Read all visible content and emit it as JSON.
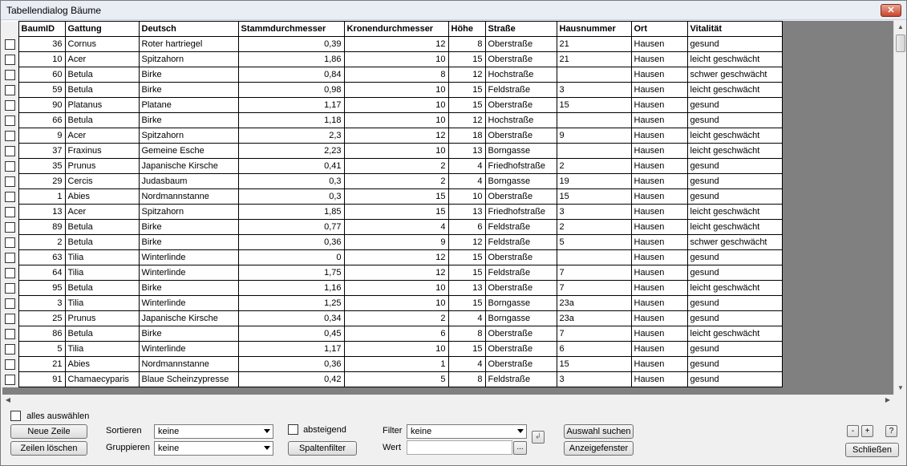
{
  "window": {
    "title": "Tabellendialog Bäume",
    "close_label": "✕"
  },
  "columns": [
    "BaumID",
    "Gattung",
    "Deutsch",
    "Stammdurchmesser",
    "Kronendurchmesser",
    "Höhe",
    "Straße",
    "Hausnummer",
    "Ort",
    "Vitalität"
  ],
  "rows": [
    [
      "36",
      "Cornus",
      "Roter hartriegel",
      "0,39",
      "12",
      "8",
      "Oberstraße",
      "21",
      "Hausen",
      "gesund"
    ],
    [
      "10",
      "Acer",
      "Spitzahorn",
      "1,86",
      "10",
      "15",
      "Oberstraße",
      "21",
      "Hausen",
      "leicht geschwächt"
    ],
    [
      "60",
      "Betula",
      "Birke",
      "0,84",
      "8",
      "12",
      "Hochstraße",
      "",
      "Hausen",
      "schwer geschwächt"
    ],
    [
      "59",
      "Betula",
      "Birke",
      "0,98",
      "10",
      "15",
      "Feldstraße",
      "3",
      "Hausen",
      "leicht geschwächt"
    ],
    [
      "90",
      "Platanus",
      "Platane",
      "1,17",
      "10",
      "15",
      "Oberstraße",
      "15",
      "Hausen",
      "gesund"
    ],
    [
      "66",
      "Betula",
      "Birke",
      "1,18",
      "10",
      "12",
      "Hochstraße",
      "",
      "Hausen",
      "gesund"
    ],
    [
      "9",
      "Acer",
      "Spitzahorn",
      "2,3",
      "12",
      "18",
      "Oberstraße",
      "9",
      "Hausen",
      "leicht geschwächt"
    ],
    [
      "37",
      "Fraxinus",
      "Gemeine Esche",
      "2,23",
      "10",
      "13",
      "Borngasse",
      "",
      "Hausen",
      "leicht geschwächt"
    ],
    [
      "35",
      "Prunus",
      "Japanische Kirsche",
      "0,41",
      "2",
      "4",
      "Friedhofstraße",
      "2",
      "Hausen",
      "gesund"
    ],
    [
      "29",
      "Cercis",
      "Judasbaum",
      "0,3",
      "2",
      "4",
      "Borngasse",
      "19",
      "Hausen",
      "gesund"
    ],
    [
      "1",
      "Abies",
      "Nordmannstanne",
      "0,3",
      "15",
      "10",
      "Oberstraße",
      "15",
      "Hausen",
      "gesund"
    ],
    [
      "13",
      "Acer",
      "Spitzahorn",
      "1,85",
      "15",
      "13",
      "Friedhofstraße",
      "3",
      "Hausen",
      "leicht geschwächt"
    ],
    [
      "89",
      "Betula",
      "Birke",
      "0,77",
      "4",
      "6",
      "Feldstraße",
      "2",
      "Hausen",
      "leicht geschwächt"
    ],
    [
      "2",
      "Betula",
      "Birke",
      "0,36",
      "9",
      "12",
      "Feldstraße",
      "5",
      "Hausen",
      "schwer geschwächt"
    ],
    [
      "63",
      "Tilia",
      "Winterlinde",
      "0",
      "12",
      "15",
      "Oberstraße",
      "",
      "Hausen",
      "gesund"
    ],
    [
      "64",
      "Tilia",
      "Winterlinde",
      "1,75",
      "12",
      "15",
      "Feldstraße",
      "7",
      "Hausen",
      "gesund"
    ],
    [
      "95",
      "Betula",
      "Birke",
      "1,16",
      "10",
      "13",
      "Oberstraße",
      "7",
      "Hausen",
      "leicht geschwächt"
    ],
    [
      "3",
      "Tilia",
      "Winterlinde",
      "1,25",
      "10",
      "15",
      "Borngasse",
      "23a",
      "Hausen",
      "gesund"
    ],
    [
      "25",
      "Prunus",
      "Japanische Kirsche",
      "0,34",
      "2",
      "4",
      "Borngasse",
      "23a",
      "Hausen",
      "gesund"
    ],
    [
      "86",
      "Betula",
      "Birke",
      "0,45",
      "6",
      "8",
      "Oberstraße",
      "7",
      "Hausen",
      "leicht geschwächt"
    ],
    [
      "5",
      "Tilia",
      "Winterlinde",
      "1,17",
      "10",
      "15",
      "Oberstraße",
      "6",
      "Hausen",
      "gesund"
    ],
    [
      "21",
      "Abies",
      "Nordmannstanne",
      "0,36",
      "1",
      "4",
      "Oberstraße",
      "15",
      "Hausen",
      "gesund"
    ],
    [
      "91",
      "Chamaecyparis",
      "Blaue Scheinzypresse",
      "0,42",
      "5",
      "8",
      "Feldstraße",
      "3",
      "Hausen",
      "gesund"
    ]
  ],
  "controls": {
    "select_all_label": "alles auswählen",
    "new_row_label": "Neue Zeile",
    "delete_rows_label": "Zeilen löschen",
    "sort_label": "Sortieren",
    "sort_value": "keine",
    "group_label": "Gruppieren",
    "group_value": "keine",
    "descending_label": "absteigend",
    "column_filter_label": "Spaltenfilter",
    "filter_label": "Filter",
    "filter_value": "keine",
    "value_label": "Wert",
    "value_input": "",
    "value_browse_label": "...",
    "search_selection_label": "Auswahl suchen",
    "display_window_label": "Anzeigefenster",
    "zoom_out_label": "-",
    "zoom_in_label": "+",
    "help_label": "?",
    "close_label": "Schließen"
  }
}
